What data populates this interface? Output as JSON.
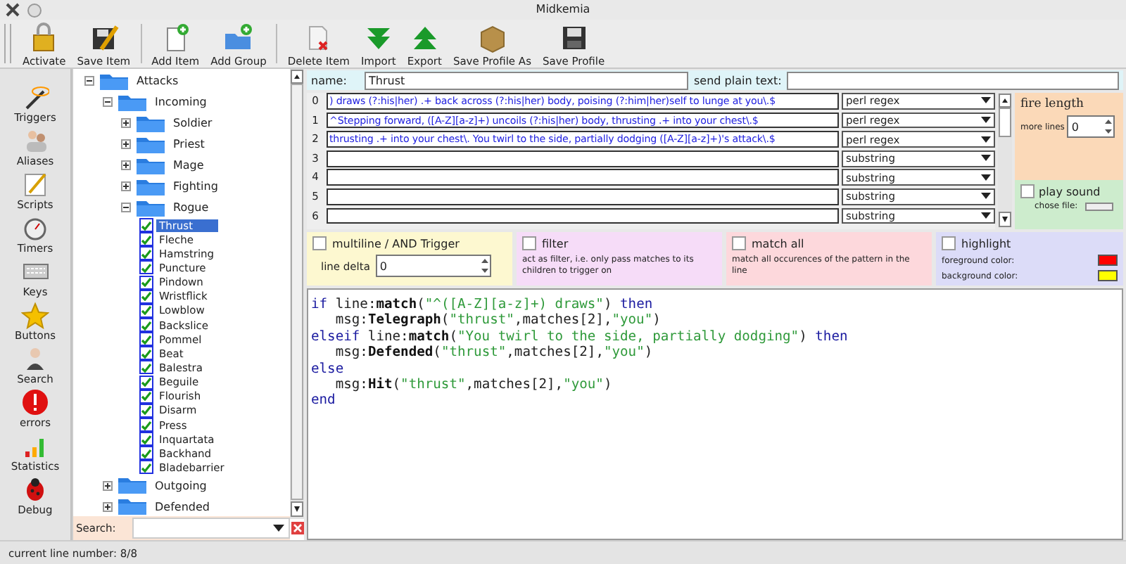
{
  "window": {
    "title": "Midkemia"
  },
  "toolbar": [
    {
      "label": "Activate"
    },
    {
      "label": "Save Item"
    },
    {
      "label": "Add Item"
    },
    {
      "label": "Add Group"
    },
    {
      "label": "Delete Item"
    },
    {
      "label": "Import"
    },
    {
      "label": "Export"
    },
    {
      "label": "Save Profile As"
    },
    {
      "label": "Save Profile"
    }
  ],
  "sidebar": {
    "items": [
      {
        "label": "Triggers"
      },
      {
        "label": "Aliases"
      },
      {
        "label": "Scripts"
      },
      {
        "label": "Timers"
      },
      {
        "label": "Keys"
      },
      {
        "label": "Buttons"
      },
      {
        "label": "Search"
      },
      {
        "label": "errors"
      },
      {
        "label": "Statistics"
      },
      {
        "label": "Debug"
      }
    ]
  },
  "tree": [
    {
      "label": "Attacks",
      "kind": "folder",
      "expanded": true,
      "children": [
        {
          "label": "Incoming",
          "kind": "folder",
          "expanded": true,
          "children": [
            {
              "label": "Soldier",
              "kind": "folder",
              "expanded": false
            },
            {
              "label": "Priest",
              "kind": "folder",
              "expanded": false
            },
            {
              "label": "Mage",
              "kind": "folder",
              "expanded": false
            },
            {
              "label": "Fighting",
              "kind": "folder",
              "expanded": false
            },
            {
              "label": "Rogue",
              "kind": "folder",
              "expanded": true,
              "children": [
                {
                  "label": "Thrust",
                  "kind": "trigger",
                  "checked": true,
                  "selected": true
                },
                {
                  "label": "Fleche",
                  "kind": "trigger",
                  "checked": true,
                  "selected": false
                },
                {
                  "label": "Hamstring",
                  "kind": "trigger",
                  "checked": true,
                  "selected": false
                },
                {
                  "label": "Puncture",
                  "kind": "trigger",
                  "checked": true,
                  "selected": false
                },
                {
                  "label": "Pindown",
                  "kind": "trigger",
                  "checked": true,
                  "selected": false
                },
                {
                  "label": "Wristflick",
                  "kind": "trigger",
                  "checked": true,
                  "selected": false
                },
                {
                  "label": "Lowblow",
                  "kind": "trigger",
                  "checked": true,
                  "selected": false
                },
                {
                  "label": "Backslice",
                  "kind": "trigger",
                  "checked": true,
                  "selected": false
                },
                {
                  "label": "Pommel",
                  "kind": "trigger",
                  "checked": true,
                  "selected": false
                },
                {
                  "label": "Beat",
                  "kind": "trigger",
                  "checked": true,
                  "selected": false
                },
                {
                  "label": "Balestra",
                  "kind": "trigger",
                  "checked": true,
                  "selected": false
                },
                {
                  "label": "Beguile",
                  "kind": "trigger",
                  "checked": true,
                  "selected": false
                },
                {
                  "label": "Flourish",
                  "kind": "trigger",
                  "checked": true,
                  "selected": false
                },
                {
                  "label": "Disarm",
                  "kind": "trigger",
                  "checked": true,
                  "selected": false
                },
                {
                  "label": "Press",
                  "kind": "trigger",
                  "checked": true,
                  "selected": false
                },
                {
                  "label": "Inquartata",
                  "kind": "trigger",
                  "checked": true,
                  "selected": false
                },
                {
                  "label": "Backhand",
                  "kind": "trigger",
                  "checked": true,
                  "selected": false
                },
                {
                  "label": "Bladebarrier",
                  "kind": "trigger",
                  "checked": true,
                  "selected": false
                }
              ]
            }
          ]
        },
        {
          "label": "Outgoing",
          "kind": "folder",
          "expanded": false
        },
        {
          "label": "Defended",
          "kind": "folder",
          "expanded": false
        }
      ]
    }
  ],
  "search": {
    "label": "Search:"
  },
  "name_row": {
    "name_label": "name:",
    "name_value": "Thrust",
    "send_label": "send plain text:"
  },
  "patterns": [
    {
      "number": "0",
      "value": ") draws (?:his|her) .+ back across (?:his|her) body, poising (?:him|her)self to lunge at you\\.$",
      "type": "perl regex"
    },
    {
      "number": "1",
      "value": "^Stepping forward, ([A-Z][a-z]+) uncoils (?:his|her) body, thrusting .+ into your chest\\.$",
      "type": "perl regex"
    },
    {
      "number": "2",
      "value": "thrusting .+ into your chest\\. You twirl to the side, partially dodging ([A-Z][a-z]+)'s attack\\.$",
      "type": "perl regex"
    },
    {
      "number": "3",
      "type": "substring"
    },
    {
      "number": "4",
      "type": "substring"
    },
    {
      "number": "5",
      "type": "substring"
    },
    {
      "number": "6",
      "type": "substring"
    }
  ],
  "fire_length": {
    "title": "fire length",
    "label": "more lines",
    "value": "0"
  },
  "play_sound": {
    "label": "play sound",
    "checked": false,
    "file_label": "chose file:"
  },
  "options": {
    "multiline": {
      "label": "multiline / AND Trigger",
      "checked": false,
      "delta_label": "line delta",
      "delta_value": "0"
    },
    "filter": {
      "label": "filter",
      "checked": false,
      "description": "act as filter, i.e. only pass matches to its children to trigger on"
    },
    "match_all": {
      "label": "match all",
      "checked": false,
      "description": "match all occurences of the pattern in the line"
    },
    "highlight": {
      "label": "highlight",
      "checked": false,
      "swatches": [
        {
          "label": "foreground color:",
          "color": "#ff0000"
        },
        {
          "label": "background color:",
          "color": "#ffff00"
        }
      ]
    }
  },
  "code": [
    [
      {
        "kind": "keyword",
        "text": "if"
      },
      {
        "kind": "plain",
        "text": " line:"
      },
      {
        "kind": "function",
        "text": "match"
      },
      {
        "kind": "plain",
        "text": "("
      },
      {
        "kind": "string",
        "text": "\"^([A-Z][a-z]+) draws\""
      },
      {
        "kind": "plain",
        "text": ") "
      },
      {
        "kind": "keyword",
        "text": "then"
      }
    ],
    [
      {
        "kind": "plain",
        "text": "   msg:"
      },
      {
        "kind": "function",
        "text": "Telegraph"
      },
      {
        "kind": "plain",
        "text": "("
      },
      {
        "kind": "string",
        "text": "\"thrust\""
      },
      {
        "kind": "plain",
        "text": ",matches[2],"
      },
      {
        "kind": "string",
        "text": "\"you\""
      },
      {
        "kind": "plain",
        "text": ")"
      }
    ],
    [
      {
        "kind": "keyword",
        "text": "elseif"
      },
      {
        "kind": "plain",
        "text": " line:"
      },
      {
        "kind": "function",
        "text": "match"
      },
      {
        "kind": "plain",
        "text": "("
      },
      {
        "kind": "string",
        "text": "\"You twirl to the side, partially dodging\""
      },
      {
        "kind": "plain",
        "text": ") "
      },
      {
        "kind": "keyword",
        "text": "then"
      }
    ],
    [
      {
        "kind": "plain",
        "text": "   msg:"
      },
      {
        "kind": "function",
        "text": "Defended"
      },
      {
        "kind": "plain",
        "text": "("
      },
      {
        "kind": "string",
        "text": "\"thrust\""
      },
      {
        "kind": "plain",
        "text": ",matches[2],"
      },
      {
        "kind": "string",
        "text": "\"you\""
      },
      {
        "kind": "plain",
        "text": ")"
      }
    ],
    [
      {
        "kind": "keyword",
        "text": "else"
      }
    ],
    [
      {
        "kind": "plain",
        "text": "   msg:"
      },
      {
        "kind": "function",
        "text": "Hit"
      },
      {
        "kind": "plain",
        "text": "("
      },
      {
        "kind": "string",
        "text": "\"thrust\""
      },
      {
        "kind": "plain",
        "text": ",matches[2],"
      },
      {
        "kind": "string",
        "text": "\"you\""
      },
      {
        "kind": "plain",
        "text": ")"
      }
    ],
    [
      {
        "kind": "keyword",
        "text": "end"
      }
    ]
  ],
  "status_bar": {
    "text": "current line number: 8/8"
  }
}
